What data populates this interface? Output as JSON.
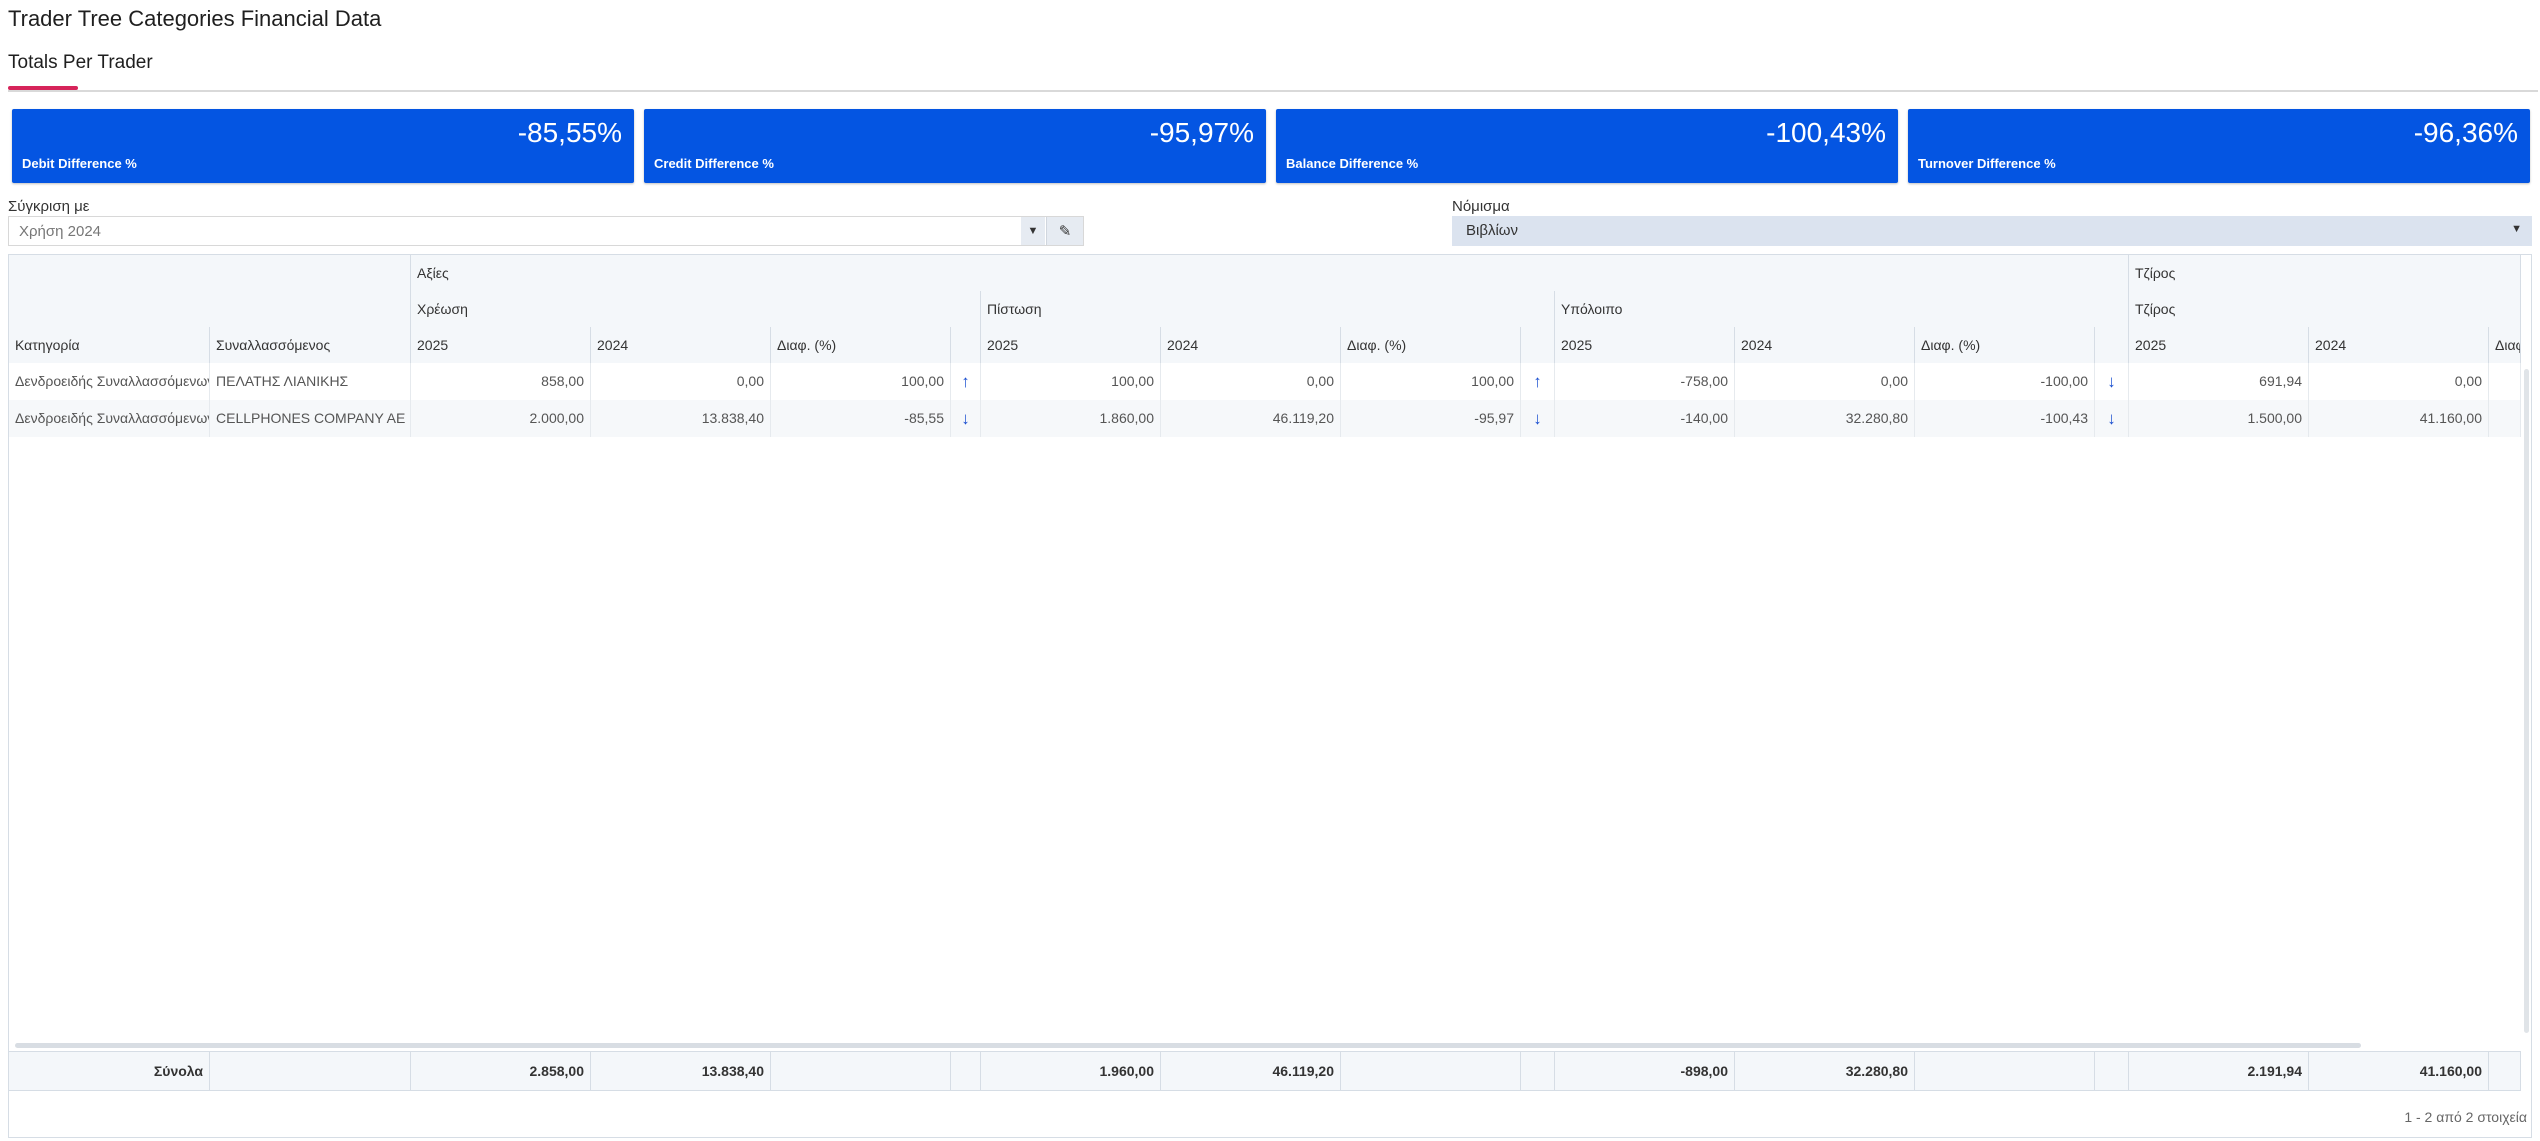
{
  "page": {
    "title": "Trader Tree Categories Financial Data"
  },
  "tabs": [
    {
      "label": "Totals Per Trader",
      "active": true
    }
  ],
  "accent_color": "#d6245a",
  "kpis": [
    {
      "value": "-85,55%",
      "label": "Debit Difference %"
    },
    {
      "value": "-95,97%",
      "label": "Credit Difference %"
    },
    {
      "value": "-100,43%",
      "label": "Balance Difference %"
    },
    {
      "value": "-96,36%",
      "label": "Turnover Difference %"
    }
  ],
  "kpi_color": "#0455e2",
  "filters": {
    "compare_label": "Σύγκριση με",
    "compare_value": "Χρήση 2024",
    "currency_label": "Νόμισμα",
    "currency_value": "Βιβλίων"
  },
  "grid": {
    "group_row1": {
      "values": "Αξίες",
      "turnover": "Τζίρος"
    },
    "group_row2": {
      "debit": "Χρέωση",
      "credit": "Πίστωση",
      "balance": "Υπόλοιπο",
      "turnover": "Τζίρος"
    },
    "columns": {
      "category": "Κατηγορία",
      "trader": "Συναλλασσόμενος",
      "y2025": "2025",
      "y2024": "2024",
      "diff": "Διαφ. (%)",
      "diff_short": "Διαφ"
    },
    "rows": [
      {
        "category": "Δενδροειδής Συναλλασσόμενων",
        "trader": "ΠΕΛΑΤΗΣ ΛΙΑΝΙΚΗΣ",
        "debit_2025": "858,00",
        "debit_2024": "0,00",
        "debit_diff": "100,00",
        "debit_arrow": "↑",
        "credit_2025": "100,00",
        "credit_2024": "0,00",
        "credit_diff": "100,00",
        "credit_arrow": "↑",
        "balance_2025": "-758,00",
        "balance_2024": "0,00",
        "balance_diff": "-100,00",
        "balance_arrow": "↓",
        "turnover_2025": "691,94",
        "turnover_2024": "0,00"
      },
      {
        "category": "Δενδροειδής Συναλλασσόμενων",
        "trader": "CELLPHONES COMPANY AE",
        "debit_2025": "2.000,00",
        "debit_2024": "13.838,40",
        "debit_diff": "-85,55",
        "debit_arrow": "↓",
        "credit_2025": "1.860,00",
        "credit_2024": "46.119,20",
        "credit_diff": "-95,97",
        "credit_arrow": "↓",
        "balance_2025": "-140,00",
        "balance_2024": "32.280,80",
        "balance_diff": "-100,43",
        "balance_arrow": "↓",
        "turnover_2025": "1.500,00",
        "turnover_2024": "41.160,00"
      }
    ],
    "totals": {
      "label": "Σύνολα",
      "debit_2025": "2.858,00",
      "debit_2024": "13.838,40",
      "credit_2025": "1.960,00",
      "credit_2024": "46.119,20",
      "balance_2025": "-898,00",
      "balance_2024": "32.280,80",
      "turnover_2025": "2.191,94",
      "turnover_2024": "41.160,00"
    },
    "pager": "1 - 2 από 2 στοιχεία"
  }
}
